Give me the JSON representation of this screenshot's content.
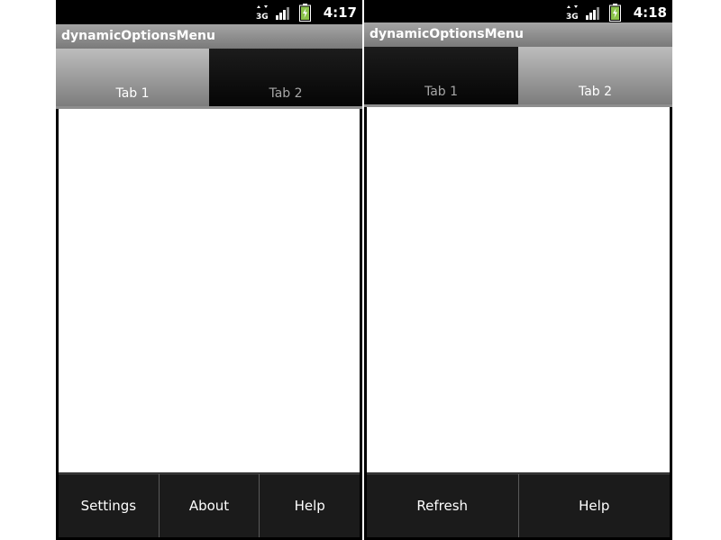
{
  "left_screen": {
    "status_bar": {
      "network": "3G",
      "time": "4:17"
    },
    "app_title": "dynamicOptionsMenu",
    "tabs": [
      {
        "label": "Tab 1",
        "selected": true
      },
      {
        "label": "Tab 2",
        "selected": false
      }
    ],
    "options_menu": [
      {
        "label": "Settings"
      },
      {
        "label": "About"
      },
      {
        "label": "Help"
      }
    ]
  },
  "right_screen": {
    "status_bar": {
      "network": "3G",
      "time": "4:18"
    },
    "app_title": "dynamicOptionsMenu",
    "tabs": [
      {
        "label": "Tab 1",
        "selected": false
      },
      {
        "label": "Tab 2",
        "selected": true
      }
    ],
    "options_menu": [
      {
        "label": "Refresh"
      },
      {
        "label": "Help"
      }
    ]
  },
  "colors": {
    "status_bar_bg": "#000000",
    "title_bar_bg": "#8c8c8c",
    "selected_tab_bg": "#a0a0a0",
    "unselected_tab_bg": "#0d0d0d",
    "menu_bg": "#1b1b1b",
    "battery_green": "#8bc34a"
  },
  "icons": [
    "3g-data-icon",
    "signal-strength-icon",
    "battery-charging-icon"
  ]
}
